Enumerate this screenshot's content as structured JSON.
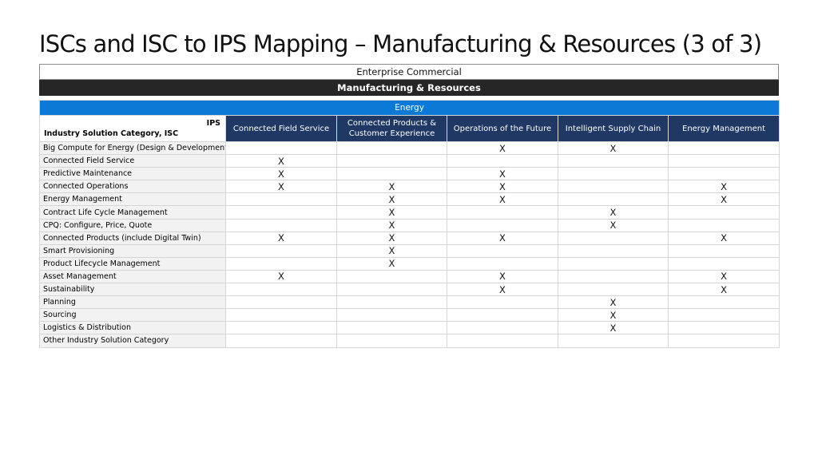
{
  "title": "ISCs and ISC to IPS Mapping – Manufacturing & Resources (3 of 3)",
  "band_top": "Enterprise Commercial",
  "band_section": "Manufacturing & Resources",
  "group_label": "Energy",
  "corner_top": "IPS",
  "corner_bottom": "Industry Solution Category, ISC",
  "columns": [
    "Connected Field Service",
    "Connected Products & Customer Experience",
    "Operations of the Future",
    "Intelligent Supply Chain",
    "Energy Management"
  ],
  "rows": [
    {
      "label": "Big Compute for Energy (Design & Development)",
      "cells": [
        "",
        "",
        "X",
        "X",
        ""
      ]
    },
    {
      "label": "Connected Field Service",
      "cells": [
        "X",
        "",
        "",
        "",
        ""
      ]
    },
    {
      "label": "Predictive Maintenance",
      "cells": [
        "X",
        "",
        "X",
        "",
        ""
      ]
    },
    {
      "label": "Connected Operations",
      "cells": [
        "X",
        "X",
        "X",
        "",
        "X"
      ]
    },
    {
      "label": "Energy Management",
      "cells": [
        "",
        "X",
        "X",
        "",
        "X"
      ]
    },
    {
      "label": "Contract Life Cycle Management",
      "cells": [
        "",
        "X",
        "",
        "X",
        ""
      ]
    },
    {
      "label": "CPQ: Configure, Price, Quote",
      "cells": [
        "",
        "X",
        "",
        "X",
        ""
      ]
    },
    {
      "label": "Connected Products (include Digital Twin)",
      "cells": [
        "X",
        "X",
        "X",
        "",
        "X"
      ]
    },
    {
      "label": "Smart Provisioning",
      "cells": [
        "",
        "X",
        "",
        "",
        ""
      ]
    },
    {
      "label": "Product Lifecycle Management",
      "cells": [
        "",
        "X",
        "",
        "",
        ""
      ]
    },
    {
      "label": "Asset Management",
      "cells": [
        "X",
        "",
        "X",
        "",
        "X"
      ]
    },
    {
      "label": "Sustainability",
      "cells": [
        "",
        "",
        "X",
        "",
        "X"
      ]
    },
    {
      "label": "Planning",
      "cells": [
        "",
        "",
        "",
        "X",
        ""
      ]
    },
    {
      "label": "Sourcing",
      "cells": [
        "",
        "",
        "",
        "X",
        ""
      ]
    },
    {
      "label": "Logistics & Distribution",
      "cells": [
        "",
        "",
        "",
        "X",
        ""
      ]
    },
    {
      "label": "Other Industry Solution Category",
      "cells": [
        "",
        "",
        "",
        "",
        ""
      ]
    }
  ],
  "colors": {
    "group_band": "#0a7ad6",
    "header": "#1f3864",
    "section_band": "#262626",
    "label_cell": "#f2f2f2"
  }
}
